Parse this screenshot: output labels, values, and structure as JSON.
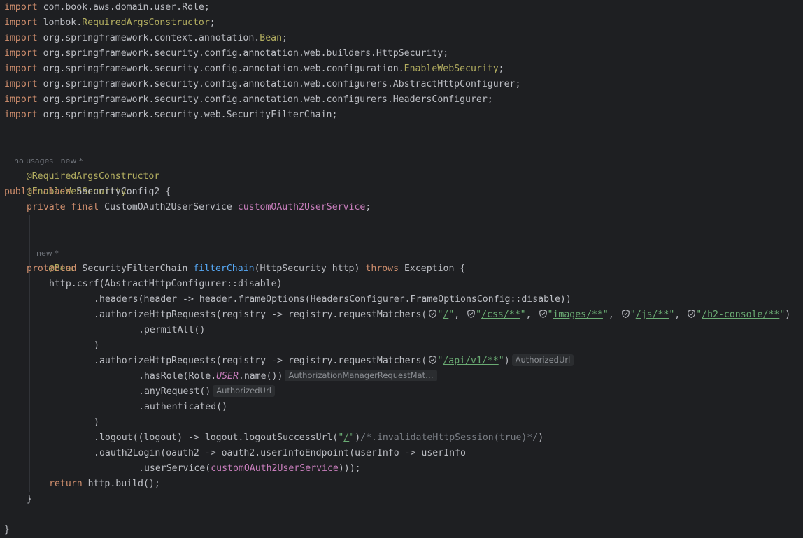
{
  "imports": [
    {
      "pkg": "com.book.aws.domain.user.",
      "cls": "Role",
      "cls_style": "plain"
    },
    {
      "pkg": "lombok.",
      "cls": "RequiredArgsConstructor",
      "cls_style": "ann"
    },
    {
      "pkg": "org.springframework.context.annotation.",
      "cls": "Bean",
      "cls_style": "ann"
    },
    {
      "pkg": "org.springframework.security.config.annotation.web.builders.",
      "cls": "HttpSecurity",
      "cls_style": "plain"
    },
    {
      "pkg": "org.springframework.security.config.annotation.web.configuration.",
      "cls": "EnableWebSecurity",
      "cls_style": "ann"
    },
    {
      "pkg": "org.springframework.security.config.annotation.web.configurers.",
      "cls": "AbstractHttpConfigurer",
      "cls_style": "plain"
    },
    {
      "pkg": "org.springframework.security.config.annotation.web.configurers.",
      "cls": "HeadersConfigurer",
      "cls_style": "plain"
    },
    {
      "pkg": "org.springframework.security.web.",
      "cls": "SecurityFilterChain",
      "cls_style": "plain"
    }
  ],
  "import_keyword": "import",
  "class_hint": {
    "usages": "no usages",
    "author": "new *"
  },
  "method_hint": "new *",
  "annotations": {
    "required_args": "@RequiredArgsConstructor",
    "enable_web_security": "@EnableWebSecurity",
    "bean": "@Bean"
  },
  "class_decl": {
    "kw": "public class",
    "name": "SecurityConfig2 {"
  },
  "field": {
    "mods": "private final",
    "type": "CustomOAuth2UserService",
    "name": "customOAuth2UserService",
    "end": ";"
  },
  "method": {
    "mod": "protected",
    "ret": "SecurityFilterChain",
    "name": "filterChain",
    "params": "(HttpSecurity http)",
    "throws_kw": "throws",
    "exc": "Exception {"
  },
  "code": {
    "csrf": "http.csrf(AbstractHttpConfigurer::disable)",
    "headers": ".headers(header -> header.frameOptions(HeadersConfigurer.FrameOptionsConfig::disable))",
    "authz1_prefix": ".authorizeHttpRequests(registry -> registry.requestMatchers(",
    "authz1_paths": [
      "/",
      "/css/**",
      "images/**",
      "/js/**",
      "/h2-console/**"
    ],
    "authz1_end": ")",
    "permit_all": ".permitAll()",
    "close_paren": ")",
    "authz2_prefix": ".authorizeHttpRequests(registry -> registry.requestMatchers(",
    "authz2_path": "/api/v1/**",
    "authz2_end": ")",
    "authz2_hint": "AuthorizedUrl",
    "has_role_pre": ".hasRole(Role.",
    "has_role_const": "USER",
    "has_role_post": ".name())",
    "has_role_hint": "AuthorizationManagerRequestMat…",
    "any_request": ".anyRequest()",
    "any_request_hint": "AuthorizedUrl",
    "authenticated": ".authenticated()",
    "logout_pre": ".logout((logout) -> logout.logoutSuccessUrl(",
    "logout_url": "/",
    "logout_mid": ")",
    "logout_comment": "/*.invalidateHttpSession(true)*/",
    "logout_end": ")",
    "oauth_line": ".oauth2Login(oauth2 -> oauth2.userInfoEndpoint(userInfo -> userInfo",
    "user_service_pre": ".userService(",
    "user_service_field": "customOAuth2UserService",
    "user_service_end": ")));",
    "return_kw": "return",
    "return_rest": " http.build();",
    "method_close": "}",
    "class_close": "}"
  },
  "colors": {
    "background": "#1e1f22",
    "keyword": "#cf8e6d",
    "annotation": "#b3ae60",
    "field": "#c77dbb",
    "method": "#56a8f5",
    "string": "#6aab73",
    "comment": "#7a7e85",
    "hint": "#6f737a"
  }
}
